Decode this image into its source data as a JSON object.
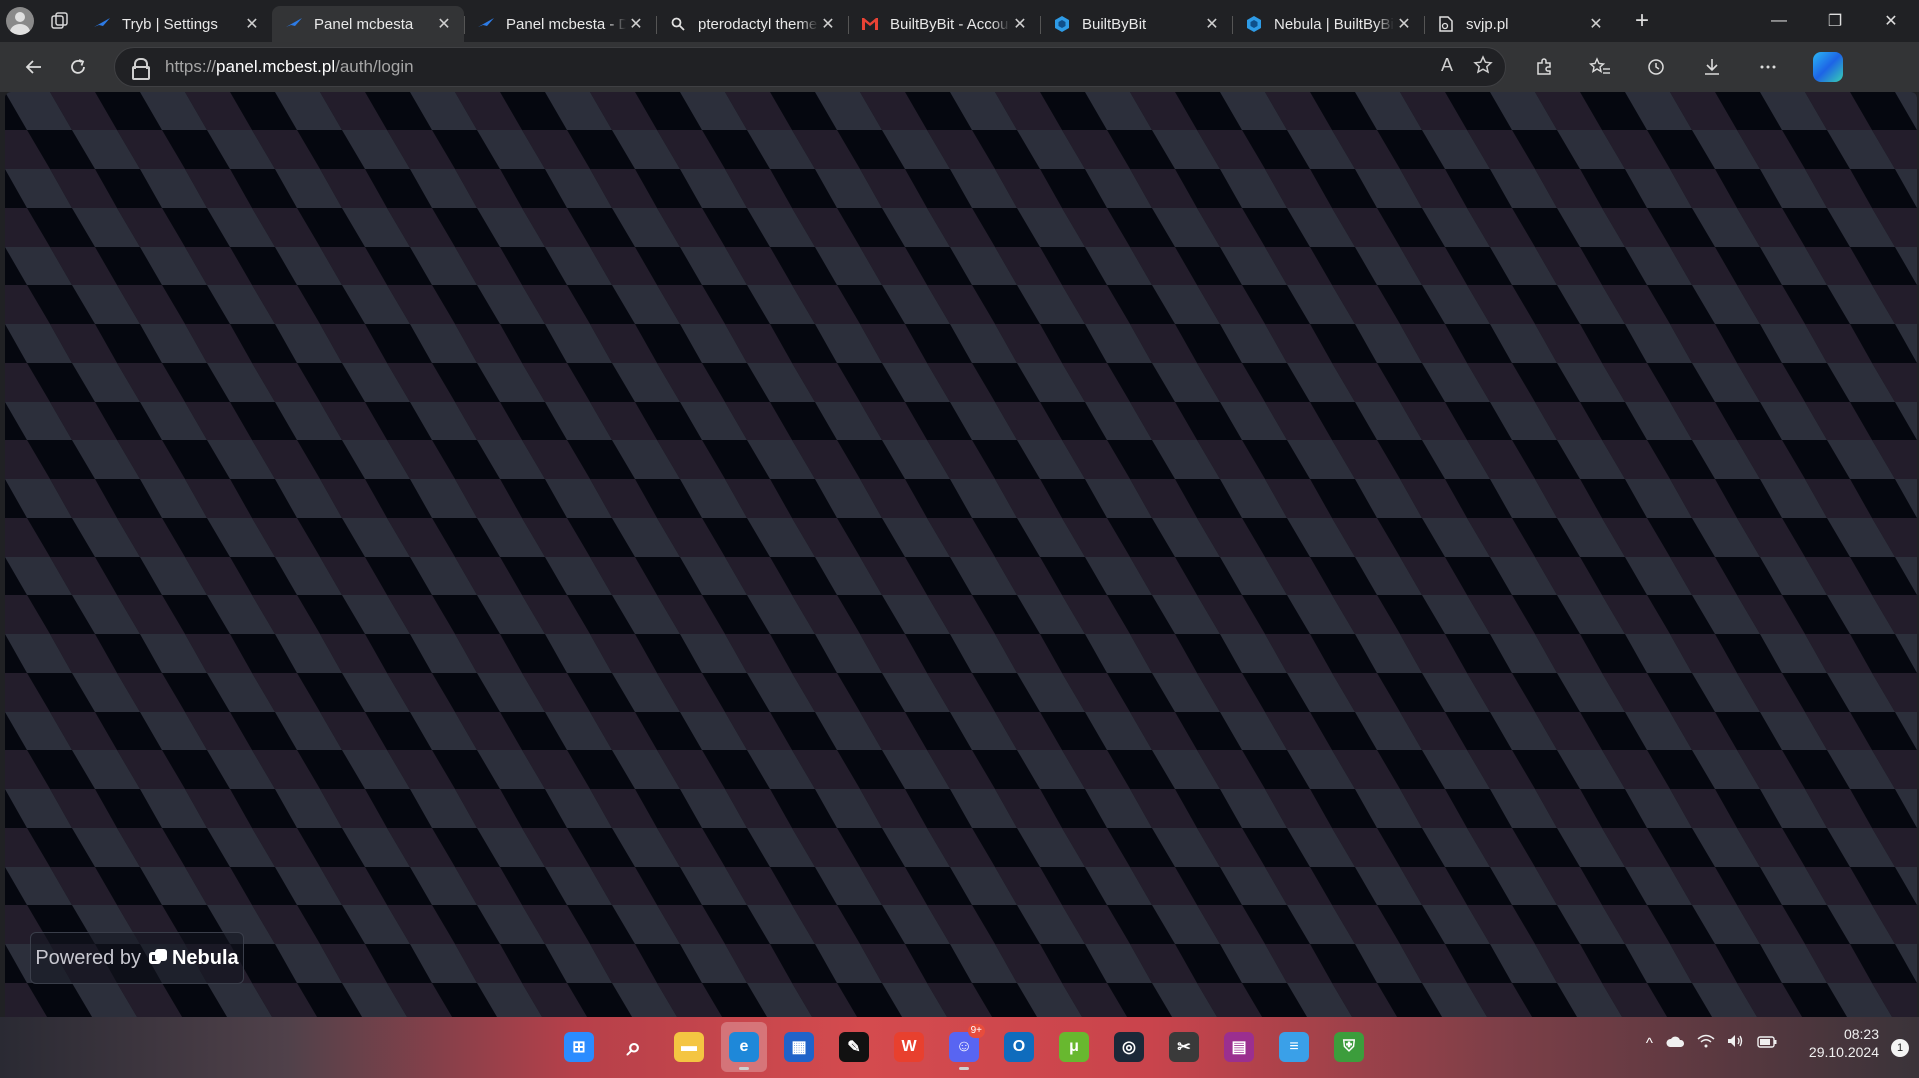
{
  "browser": {
    "tabs": [
      {
        "title": "Tryb | Settings",
        "favicon": "pterodactyl-icon",
        "active": false
      },
      {
        "title": "Panel mcbesta",
        "favicon": "pterodactyl-icon",
        "active": true
      },
      {
        "title": "Panel mcbesta - Dashboard",
        "favicon": "pterodactyl-icon",
        "active": false
      },
      {
        "title": "pterodactyl theme",
        "favicon": "search-icon",
        "active": false
      },
      {
        "title": "BuiltByBit - Account",
        "favicon": "gmail-icon",
        "active": false
      },
      {
        "title": "BuiltByBit",
        "favicon": "builtbybit-icon",
        "active": false
      },
      {
        "title": "Nebula | BuiltByBit",
        "favicon": "builtbybit-icon",
        "active": false
      },
      {
        "title": "svjp.pl",
        "favicon": "page-icon",
        "active": false
      }
    ],
    "close_glyph": "✕",
    "new_tab_glyph": "+",
    "address": {
      "scheme": "https://",
      "host": "panel.mcbest.pl",
      "path": "/auth/login"
    },
    "read_aloud_glyph": "A",
    "window": {
      "minimize": "—",
      "restore": "❐",
      "close": "✕"
    }
  },
  "page": {
    "powered_by": {
      "prefix": "Powered by",
      "brand": "Nebula"
    },
    "colors": {
      "face_light": "#2c2f3b",
      "face_dark": "#05070f",
      "face_mid": "#231d2b"
    }
  },
  "taskbar": {
    "apps": [
      {
        "name": "start-icon",
        "glyph": "⊞",
        "color": "#2b8cff"
      },
      {
        "name": "search-icon",
        "glyph": "⌕",
        "color": "transparent"
      },
      {
        "name": "file-explorer-icon",
        "glyph": "▬",
        "color": "#f4c542"
      },
      {
        "name": "edge-icon",
        "glyph": "e",
        "color": "#1e88d9",
        "active": true
      },
      {
        "name": "store-icon",
        "glyph": "▦",
        "color": "#2063c9"
      },
      {
        "name": "feather-app-icon",
        "glyph": "✎",
        "color": "#111111"
      },
      {
        "name": "wps-office-icon",
        "glyph": "W",
        "color": "#e8402e"
      },
      {
        "name": "discord-icon",
        "glyph": "☺",
        "color": "#5865f2",
        "badge": "9+"
      },
      {
        "name": "outlook-icon",
        "glyph": "O",
        "color": "#0f6cbd"
      },
      {
        "name": "utorrent-icon",
        "glyph": "μ",
        "color": "#68b82f"
      },
      {
        "name": "steam-icon",
        "glyph": "◎",
        "color": "#1b2838"
      },
      {
        "name": "snipping-tool-icon",
        "glyph": "✂",
        "color": "#3a3a3a"
      },
      {
        "name": "winrar-icon",
        "glyph": "▤",
        "color": "#9b2f8f"
      },
      {
        "name": "notepad-icon",
        "glyph": "≡",
        "color": "#3aa0e8"
      },
      {
        "name": "vpn-icon",
        "glyph": "⛨",
        "color": "#3c9d3c"
      }
    ],
    "tray": {
      "chevron": "^",
      "time": "08:23",
      "date": "29.10.2024",
      "notifications": "1"
    }
  }
}
